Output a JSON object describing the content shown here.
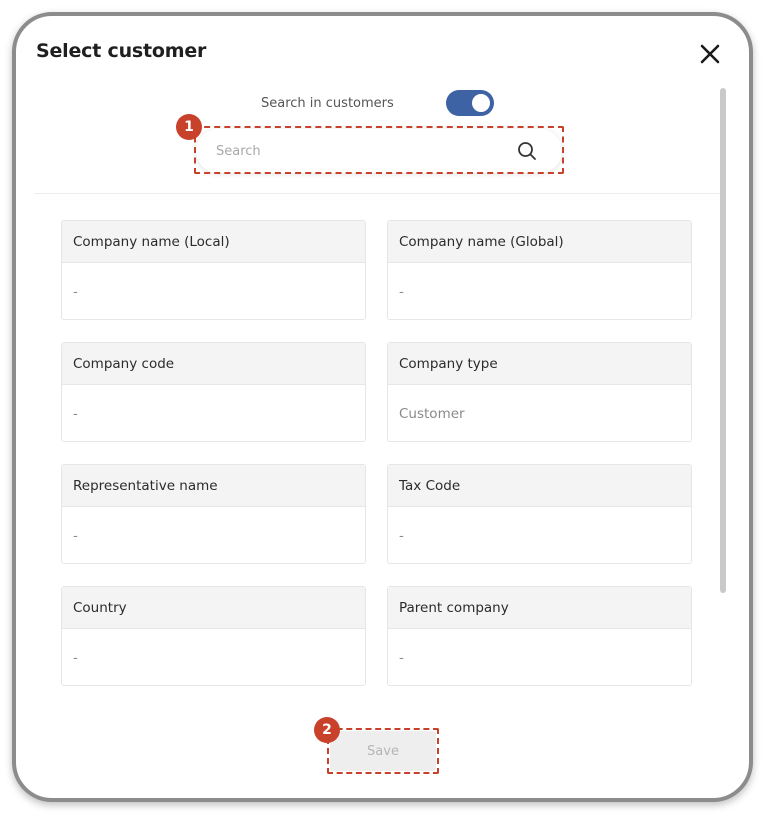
{
  "dialog": {
    "title": "Select customer",
    "close_icon": "close-icon"
  },
  "search_toggle": {
    "label": "Search in customers",
    "on": true,
    "color": "#3d63a4"
  },
  "search": {
    "placeholder": "Search",
    "value": "",
    "icon": "search-icon"
  },
  "fields": [
    {
      "label": "Company name (Local)",
      "value": "-"
    },
    {
      "label": "Company name (Global)",
      "value": "-"
    },
    {
      "label": "Company code",
      "value": "-"
    },
    {
      "label": "Company type",
      "value": "Customer"
    },
    {
      "label": "Representative name",
      "value": "-"
    },
    {
      "label": "Tax Code",
      "value": "-"
    },
    {
      "label": "Country",
      "value": "-"
    },
    {
      "label": "Parent company",
      "value": "-"
    }
  ],
  "footer": {
    "save_label": "Save"
  },
  "callouts": [
    {
      "number": "1",
      "target": "search"
    },
    {
      "number": "2",
      "target": "save"
    }
  ],
  "colors": {
    "callout": "#c8412b",
    "toggle": "#3d63a4"
  }
}
